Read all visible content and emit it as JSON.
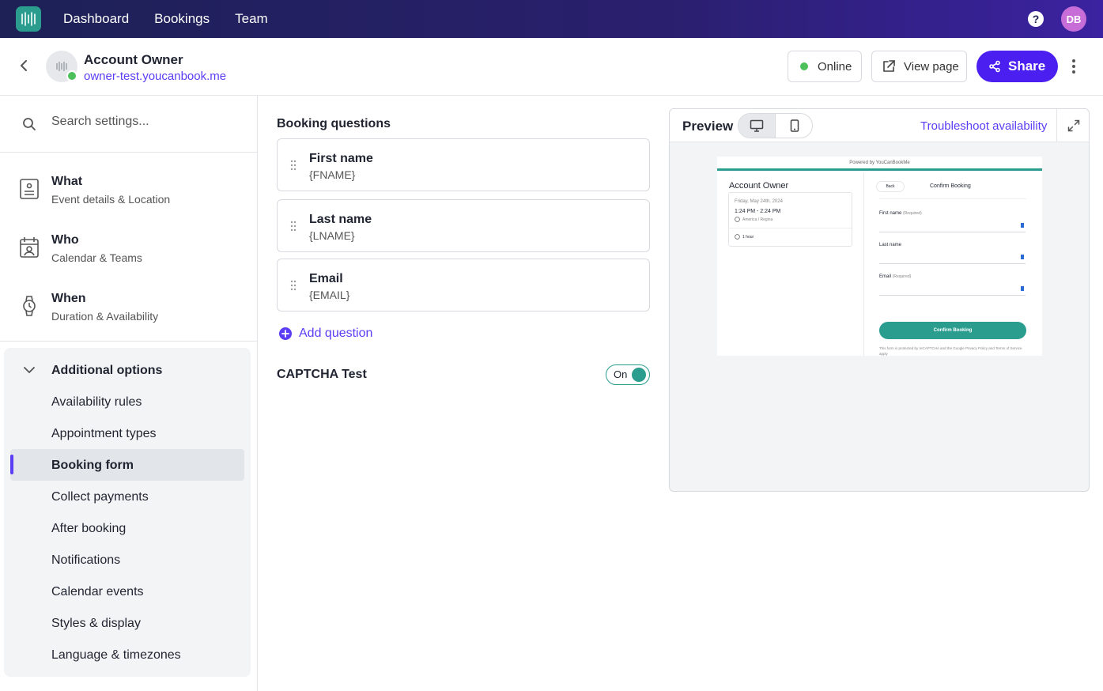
{
  "topnav": {
    "items": [
      "Dashboard",
      "Bookings",
      "Team"
    ],
    "help": "?",
    "avatar_initials": "DB"
  },
  "header": {
    "title": "Account Owner",
    "url": "owner-test.youcanbook.me",
    "online_label": "Online",
    "view_page_label": "View page",
    "share_label": "Share"
  },
  "sidebar": {
    "search_placeholder": "Search settings...",
    "main_items": [
      {
        "title": "What",
        "subtitle": "Event details & Location",
        "icon": "document-icon"
      },
      {
        "title": "Who",
        "subtitle": "Calendar & Teams",
        "icon": "calendar-person-icon"
      },
      {
        "title": "When",
        "subtitle": "Duration & Availability",
        "icon": "watch-icon"
      }
    ],
    "additional_title": "Additional options",
    "sub_items": [
      "Availability rules",
      "Appointment types",
      "Booking form",
      "Collect payments",
      "After booking",
      "Notifications",
      "Calendar events",
      "Styles & display",
      "Language & timezones"
    ],
    "active_sub_item": "Booking form"
  },
  "main": {
    "section_title": "Booking questions",
    "questions": [
      {
        "name": "First name",
        "token": "{FNAME}"
      },
      {
        "name": "Last name",
        "token": "{LNAME}"
      },
      {
        "name": "Email",
        "token": "{EMAIL}"
      }
    ],
    "add_question_label": "Add question",
    "captcha_label": "CAPTCHA Test",
    "captcha_toggle": "On"
  },
  "preview": {
    "title": "Preview",
    "troubleshoot_label": "Troubleshoot availability",
    "mode": "desktop",
    "mini": {
      "powered_by": "Powered by YouCanBookMe",
      "account_name": "Account Owner",
      "date": "Friday, May 24th, 2024",
      "time": "1:24 PM - 2:24 PM",
      "timezone": "America / Regina",
      "duration": "1 hour",
      "back": "Back",
      "heading": "Confirm Booking",
      "fields": [
        {
          "label": "First name",
          "required": "(Required)"
        },
        {
          "label": "Last name",
          "required": ""
        },
        {
          "label": "Email",
          "required": "(Required)"
        }
      ],
      "button": "Confirm Booking",
      "footer": "This form is protected by reCAPTCHA and the Google Privacy Policy and Terms of Service apply"
    }
  },
  "colors": {
    "accent": "#5b3df5",
    "share": "#4a1ff0",
    "teal": "#2a9d8f",
    "online": "#4cc05a"
  }
}
